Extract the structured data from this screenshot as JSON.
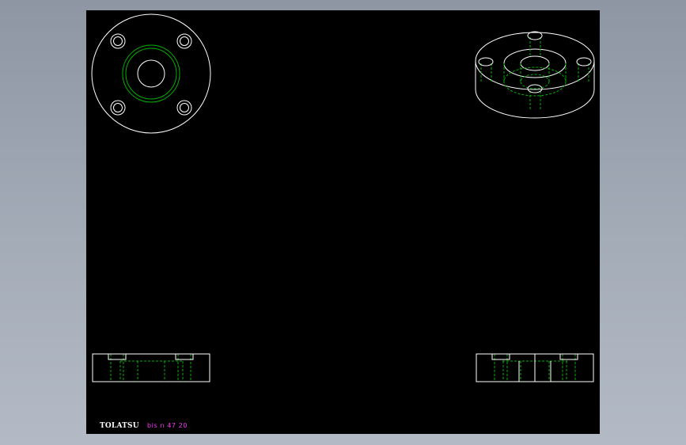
{
  "title_block": {
    "brand": "TOLATSU",
    "part_code": "bis n 47 20"
  },
  "colors": {
    "background": "#9aa2ae",
    "canvas": "#000000",
    "visible_line": "#ffffff",
    "hidden_line": "#00b000",
    "annotation": "#ff33ff"
  },
  "views": [
    "top-view",
    "isometric-view",
    "front-section-view",
    "side-section-view"
  ]
}
